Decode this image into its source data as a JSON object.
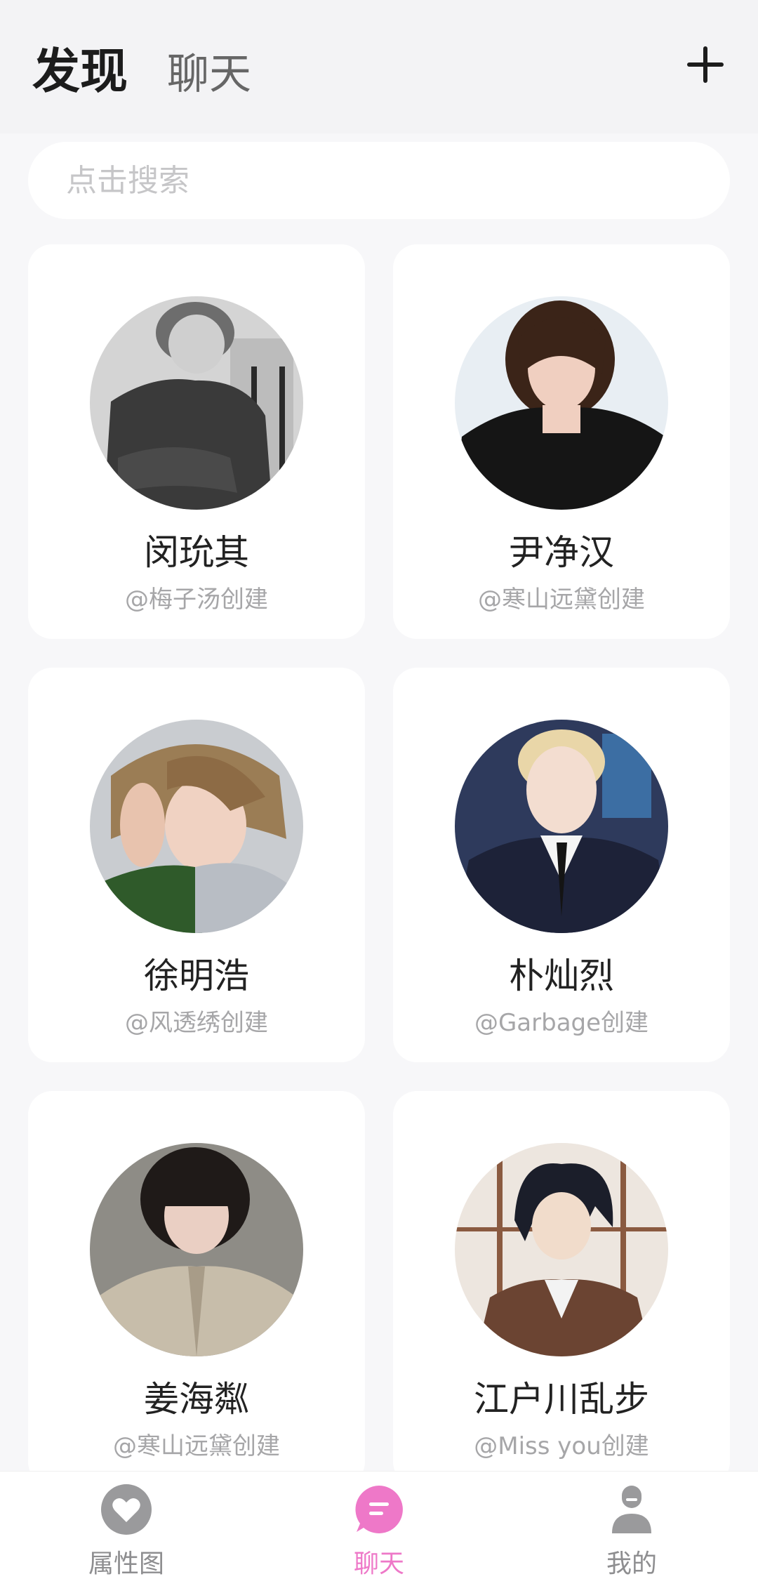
{
  "header": {
    "tabs": [
      "发现",
      "聊天"
    ]
  },
  "search": {
    "placeholder": "点击搜索"
  },
  "cards": [
    {
      "name": "闵玧其",
      "creator": "@梅子汤创建"
    },
    {
      "name": "尹净汉",
      "creator": "@寒山远黛创建"
    },
    {
      "name": "徐明浩",
      "creator": "@风透绣创建"
    },
    {
      "name": "朴灿烈",
      "creator": "@Garbage创建"
    },
    {
      "name": "姜海粼",
      "creator": "@寒山远黛创建"
    },
    {
      "name": "江户川乱步",
      "creator": "@Miss you创建"
    }
  ],
  "bottom_nav": {
    "items": [
      {
        "label": "属性图",
        "icon": "heart-icon",
        "active": false
      },
      {
        "label": "聊天",
        "icon": "chat-bubble-icon",
        "active": true
      },
      {
        "label": "我的",
        "icon": "person-icon",
        "active": false
      }
    ]
  },
  "colors": {
    "accent": "#ee78c8",
    "inactive": "#8e8e90",
    "background": "#f7f7f9"
  }
}
